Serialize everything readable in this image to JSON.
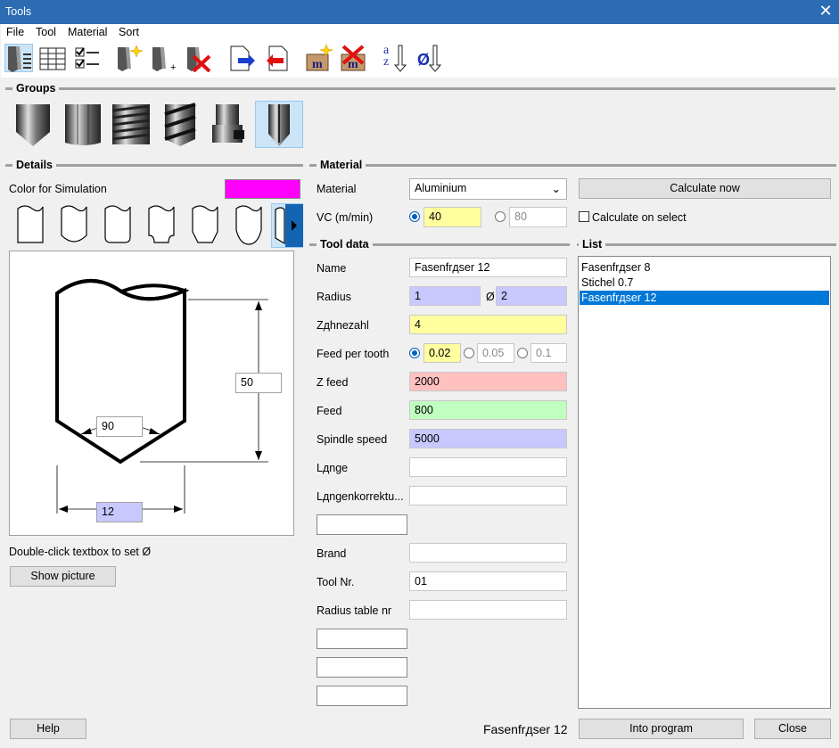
{
  "window": {
    "title": "Tools"
  },
  "menu": [
    "File",
    "Tool",
    "Material",
    "Sort"
  ],
  "toolbar": {
    "icons": [
      "tool-list-view-icon",
      "table-view-icon",
      "checklist-icon",
      "new-tool-icon",
      "add-tool-icon",
      "delete-tool-icon",
      "import-icon",
      "export-icon",
      "new-material-icon",
      "delete-material-icon",
      "sort-alpha-icon",
      "sort-diameter-icon"
    ],
    "sort_alpha_label": "az",
    "sort_diameter_label": "Ø",
    "material_label": "m"
  },
  "groups": {
    "label": "Groups",
    "selected_index": 5
  },
  "details": {
    "label": "Details",
    "color_label": "Color for Simulation",
    "color_value": "#ff00ff",
    "drawing": {
      "height_value": "50",
      "angle_value": "90",
      "diameter_value": "12"
    },
    "hint": "Double-click textbox to set Ø",
    "show_picture": "Show picture"
  },
  "material": {
    "label": "Material",
    "material_label": "Material",
    "material_value": "Aluminium",
    "vc_label": "VC (m/min)",
    "vc_value": "40",
    "vc_alt": "80",
    "calculate_now": "Calculate now",
    "calculate_on_select": "Calculate on select"
  },
  "tool_data": {
    "label": "Tool data",
    "name_label": "Name",
    "name_value": "Fasenfrдser 12",
    "radius_label": "Radius",
    "radius_value": "1",
    "diameter_symbol": "Ø",
    "diameter_value": "2",
    "teeth_label": "Zдhnezahl",
    "teeth_value": "4",
    "feed_tooth_label": "Feed per tooth",
    "feed_tooth_value": "0.02",
    "feed_tooth_alt1": "0.05",
    "feed_tooth_alt2": "0.1",
    "zfeed_label": "Z feed",
    "zfeed_value": "2000",
    "feed_label": "Feed",
    "feed_value": "800",
    "spindle_label": "Spindle speed",
    "spindle_value": "5000",
    "length_label": "Lдnge",
    "length_value": "",
    "length_corr_label": "Lдngenkorrektu...",
    "length_corr_value": "",
    "brand_label": "Brand",
    "brand_value": "",
    "tool_nr_label": "Tool Nr.",
    "tool_nr_value": "01",
    "radius_table_label": "Radius table nr",
    "radius_table_value": ""
  },
  "list": {
    "label": "List",
    "items": [
      "Fasenfrдser 8",
      "Stichel 0.7",
      "Fasenfrдser 12"
    ],
    "selected_index": 2
  },
  "footer": {
    "help": "Help",
    "current_tool": "Fasenfrдser 12",
    "into_program": "Into program",
    "close": "Close"
  },
  "colors": {
    "yellow": "#ffffa0",
    "lavender": "#c8c8ff",
    "pink": "#ffc0c0",
    "green": "#c0ffc0",
    "accent": "#0078d7"
  }
}
